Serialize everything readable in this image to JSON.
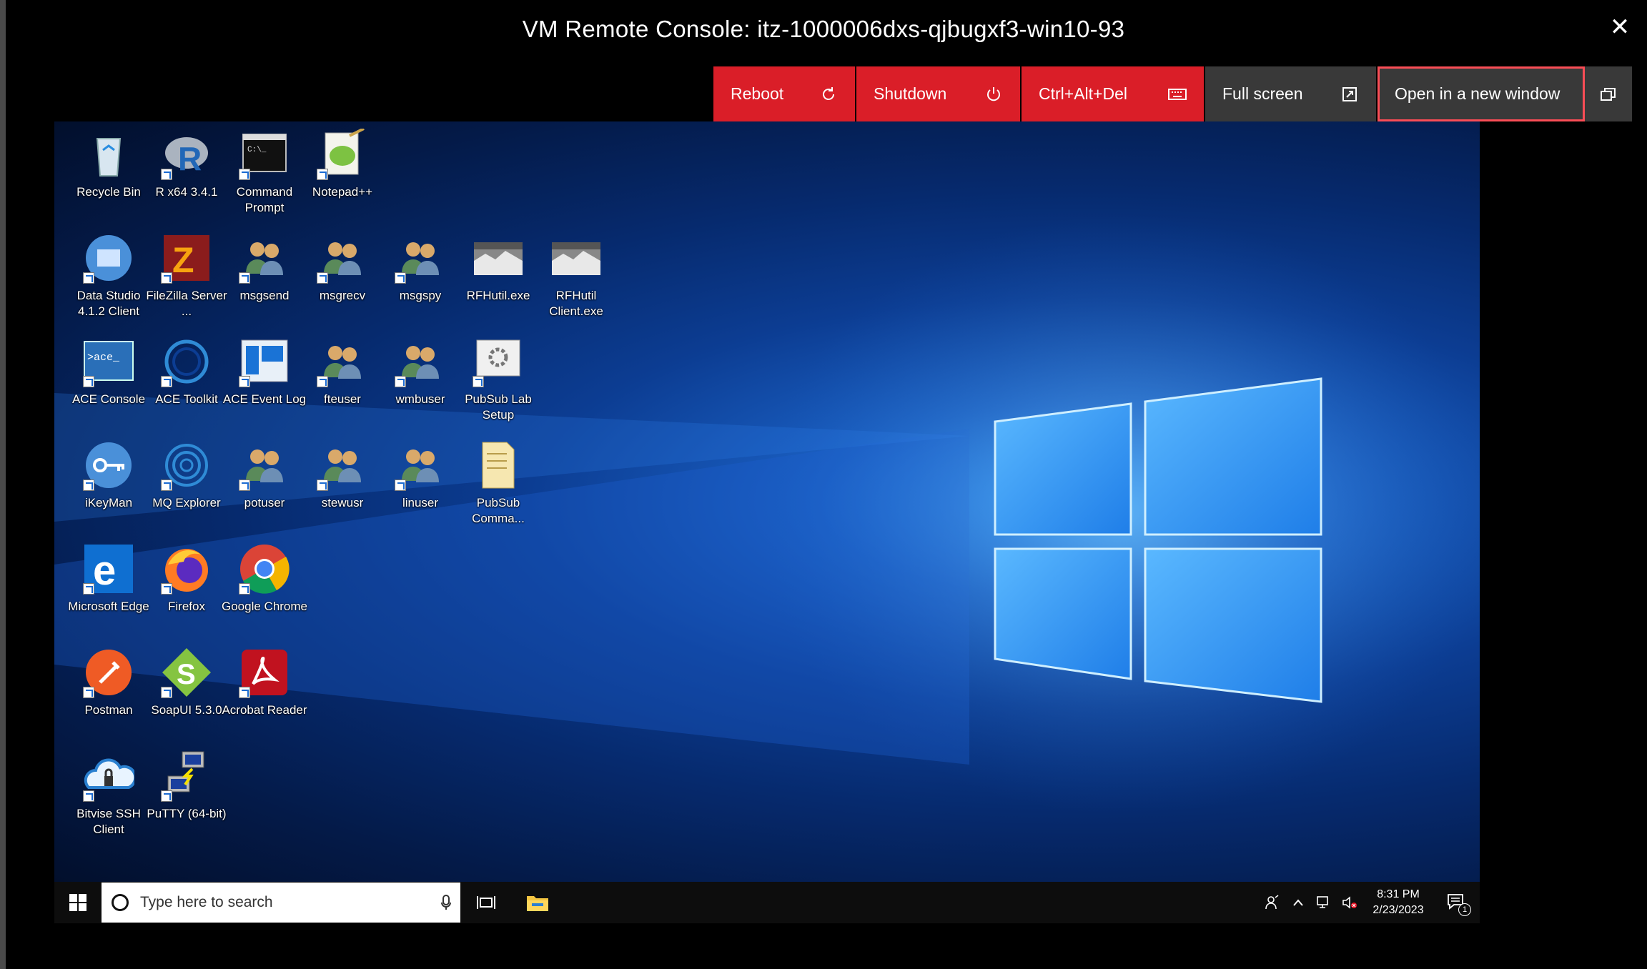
{
  "window": {
    "title": "VM Remote Console: itz-1000006dxs-qjbugxf3-win10-93",
    "close_glyph": "✕"
  },
  "toolbar": {
    "reboot": "Reboot",
    "shutdown": "Shutdown",
    "ctrl_alt_del": "Ctrl+Alt+Del",
    "full_screen": "Full screen",
    "open_new_window": "Open in a new window"
  },
  "colors": {
    "red": "#da1e28",
    "gray": "#393939",
    "highlight": "#fa4d56"
  },
  "desktop": {
    "icons": [
      {
        "label": "Recycle Bin",
        "icon": "recycle-bin-icon"
      },
      {
        "label": "R x64 3.4.1",
        "icon": "r-icon"
      },
      {
        "label": "Command Prompt",
        "icon": "cmd-icon"
      },
      {
        "label": "Notepad++",
        "icon": "notepadpp-icon"
      },
      {
        "label": "Data Studio 4.1.2 Client",
        "icon": "data-studio-icon"
      },
      {
        "label": "FileZilla Server ...",
        "icon": "filezilla-icon"
      },
      {
        "label": "msgsend",
        "icon": "users-icon"
      },
      {
        "label": "msgrecv",
        "icon": "users-icon"
      },
      {
        "label": "msgspy",
        "icon": "users-icon"
      },
      {
        "label": "RFHutil.exe",
        "icon": "rfhutil-icon"
      },
      {
        "label": "RFHutil Client.exe",
        "icon": "rfhutil-icon"
      },
      {
        "label": "ACE Console",
        "icon": "ace-console-icon"
      },
      {
        "label": "ACE Toolkit",
        "icon": "ace-toolkit-icon"
      },
      {
        "label": "ACE Event Log",
        "icon": "ace-eventlog-icon"
      },
      {
        "label": "fteuser",
        "icon": "users-icon"
      },
      {
        "label": "wmbuser",
        "icon": "users-icon"
      },
      {
        "label": "PubSub Lab Setup",
        "icon": "gear-doc-icon"
      },
      {
        "label": "iKeyMan",
        "icon": "ikeyman-icon"
      },
      {
        "label": "MQ Explorer",
        "icon": "mq-explorer-icon"
      },
      {
        "label": "potuser",
        "icon": "users-icon"
      },
      {
        "label": "stewusr",
        "icon": "users-icon"
      },
      {
        "label": "linuser",
        "icon": "users-icon"
      },
      {
        "label": "PubSub Comma...",
        "icon": "folder-doc-icon"
      },
      {
        "label": "Microsoft Edge",
        "icon": "edge-icon"
      },
      {
        "label": "Firefox",
        "icon": "firefox-icon"
      },
      {
        "label": "Google Chrome",
        "icon": "chrome-icon"
      },
      {
        "label": "Postman",
        "icon": "postman-icon"
      },
      {
        "label": "SoapUI 5.3.0",
        "icon": "soapui-icon"
      },
      {
        "label": "Acrobat Reader",
        "icon": "acrobat-icon"
      },
      {
        "label": "Bitvise SSH Client",
        "icon": "bitvise-icon"
      },
      {
        "label": "PuTTY (64-bit)",
        "icon": "putty-icon"
      }
    ]
  },
  "taskbar": {
    "search_placeholder": "Type here to search",
    "time": "8:31 PM",
    "date": "2/23/2023",
    "notification_count": "1"
  }
}
